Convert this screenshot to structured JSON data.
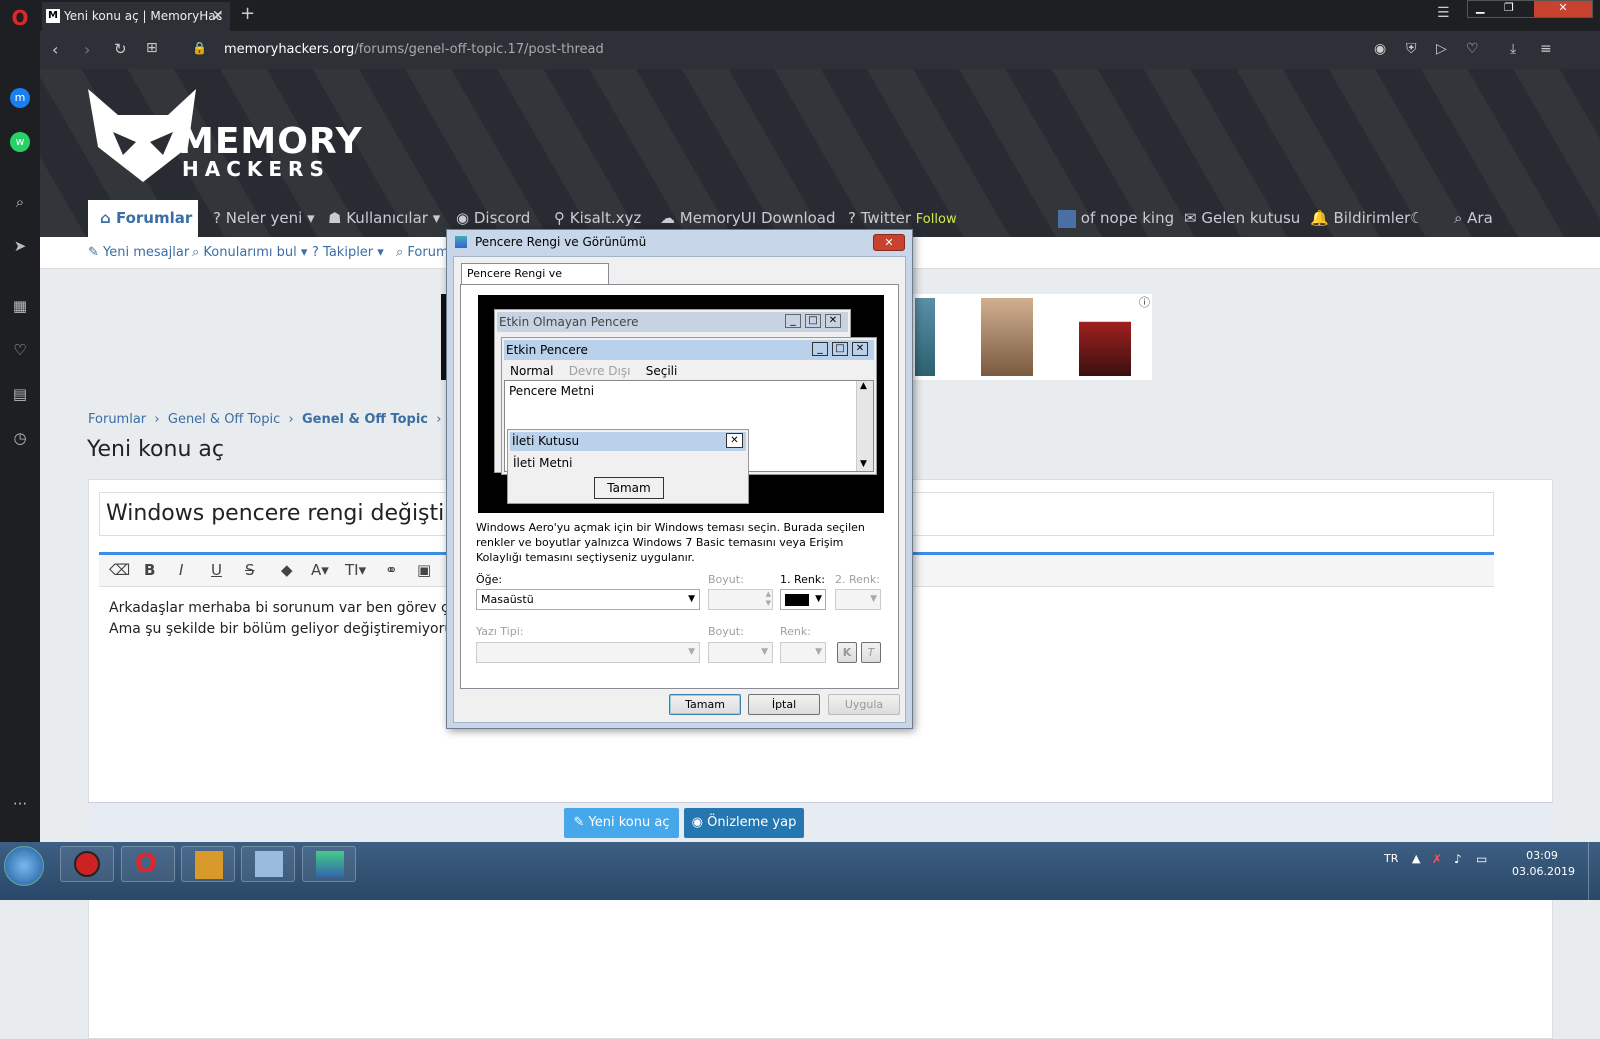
{
  "browser": {
    "tab_title": "Yeni konu aç | MemoryHac",
    "url_host": "memoryhackers.org",
    "url_path": "/forums/genel-off-topic.17/post-thread"
  },
  "site": {
    "logo_top": "MEMORY",
    "logo_bottom": "HACKERS",
    "nav": [
      "Forumlar",
      "Neler yeni",
      "Kullanıcılar",
      "Discord",
      "Kisalt.xyz",
      "MemoryUI Download",
      "Twitter",
      "Follow"
    ],
    "user": "of nope king",
    "inbox": "Gelen kutusu",
    "alerts": "Bildirimler",
    "search": "Ara",
    "subnav": [
      "Yeni mesajlar",
      "Konularımı bul",
      "Takipler",
      "Forum"
    ],
    "breadcrumb": [
      "Forumlar",
      "Genel & Off Topic",
      "Genel & Off Topic"
    ],
    "page_title": "Yeni konu aç",
    "thread_title": "Windows pencere rengi değiştirm",
    "body_line1": "Arkadaşlar merhaba bi sorunum var ben görev çubu",
    "body_line2": "Ama şu şekilde bir bölüm geliyor değiştiremiyorum.",
    "btn_post": "Yeni konu aç",
    "btn_preview": "Önizleme yap"
  },
  "dialog": {
    "title": "Pencere Rengi ve Görünümü",
    "tab": "Pencere Rengi ve Görünümü",
    "inactive": "Etkin Olmayan Pencere",
    "active": "Etkin Pencere",
    "menu": [
      "Normal",
      "Devre Dışı",
      "Seçili"
    ],
    "window_text": "Pencere Metni",
    "msgbox_title": "İleti Kutusu",
    "msgbox_text": "İleti Metni",
    "msgbox_ok": "Tamam",
    "description": "Windows Aero'yu açmak için bir Windows teması seçin. Burada seçilen renkler ve boyutlar yalnızca Windows 7 Basic temasını veya Erişim Kolaylığı temasını seçtiyseniz uygulanır.",
    "item_label": "Öğe:",
    "item_value": "Masaüstü",
    "size_label": "Boyut:",
    "color1_label": "1. Renk:",
    "color2_label": "2. Renk:",
    "font_label": "Yazı Tipi:",
    "size2_label": "Boyut:",
    "color_label": "Renk:",
    "bold": "K",
    "italic": "T",
    "ok": "Tamam",
    "cancel": "İptal",
    "apply": "Uygula"
  },
  "taskbar": {
    "lang": "TR",
    "time": "03:09",
    "date": "03.06.2019"
  }
}
